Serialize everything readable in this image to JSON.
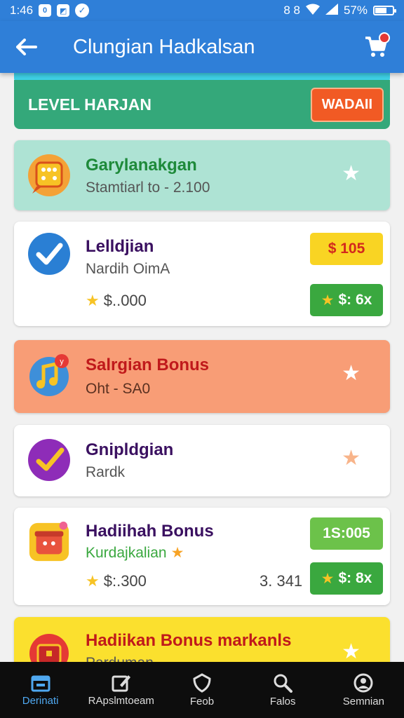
{
  "status_bar": {
    "time": "1:46",
    "left_icons": [
      "0",
      "media-icon",
      "check-circle-icon"
    ],
    "right_text": "8 8",
    "battery": "57%"
  },
  "app_bar": {
    "title": "Clungian Hadkalsan",
    "back_icon": "arrow-left-icon",
    "cart_icon": "cart-icon"
  },
  "level_header": {
    "label": "LEVEL HARJAN",
    "button": "WADAII"
  },
  "cards": [
    {
      "title": "Garylanakgan",
      "subtitle": "Stamtiarl to - 2.100",
      "star_icon": "star-icon",
      "bg": "#aee3d4",
      "title_color": "#1e8a3a"
    },
    {
      "title": "Lelldjian",
      "subtitle": "Nardih OimA",
      "price": "$..000",
      "pill_top": "$ 105",
      "pill_bottom": "$: 6x",
      "bg": "#ffffff",
      "title_color": "#3a1060"
    },
    {
      "title": "Salrgian Bonus",
      "subtitle": "Oht - SA0",
      "star_icon": "star-icon",
      "bg": "#f89d76",
      "title_color": "#c0191b"
    },
    {
      "title": "Gnipldgian",
      "subtitle": "Rardk",
      "star_icon": "star-icon",
      "bg": "#ffffff",
      "title_color": "#3a1060"
    },
    {
      "title": "Hadiihah Bonus",
      "subtitle": "Kurdajkalian",
      "price": "$:.300",
      "amount": "3. 341",
      "pill_top": "1S:005",
      "pill_bottom": "$: 8x",
      "bg": "#ffffff",
      "title_color": "#3a1060"
    },
    {
      "title": "Hadiikan Bonus markanls",
      "subtitle": "Parduman",
      "star_icon": "star-icon",
      "bg": "#fbe02e",
      "title_color": "#c0191b"
    }
  ],
  "bottom_nav": [
    {
      "label": "Derinati",
      "icon": "store-icon",
      "active": true
    },
    {
      "label": "RApslmtoeam",
      "icon": "edit-icon",
      "active": false
    },
    {
      "label": "Feob",
      "icon": "shield-icon",
      "active": false
    },
    {
      "label": "Falos",
      "icon": "search-icon",
      "active": false
    },
    {
      "label": "Semnian",
      "icon": "profile-icon",
      "active": false
    }
  ]
}
